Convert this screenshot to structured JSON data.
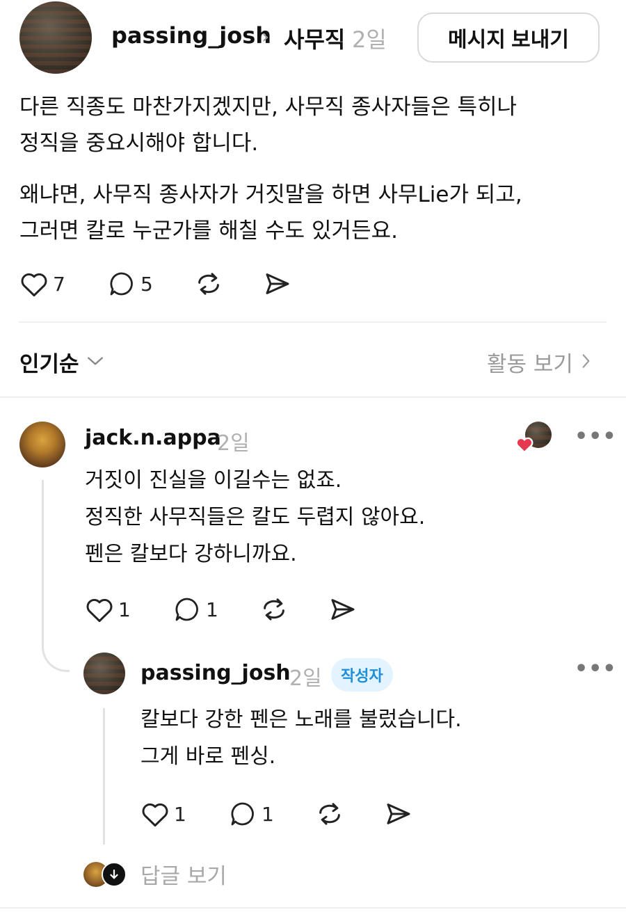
{
  "post": {
    "author": "passing_josh",
    "separator": "›",
    "category": "사무직",
    "time": "2일",
    "message_button": "메시지 보내기",
    "paragraphs": [
      "다른 직종도 마찬가지겠지만, 사무직 종사자들은 특히나",
      "정직을 중요시해야 합니다.",
      "왜냐면, 사무직 종사자가 거짓말을 하면 사무Lie가 되고,",
      "그러면 칼로 누군가를 해칠 수도 있거든요."
    ],
    "likes": "7",
    "comments": "5"
  },
  "sort": {
    "label": "인기순",
    "activity_link": "활동 보기"
  },
  "comments": [
    {
      "author": "jack.n.appa",
      "time": "2일",
      "lines": [
        "거짓이 진실을 이길수는 없죠.",
        "정직한 사무직들은 칼도 두렵지 않아요.",
        "펜은 칼보다 강하니까요."
      ],
      "likes": "1",
      "replies": "1",
      "more": "•••"
    },
    {
      "author": "passing_josh",
      "time": "2일",
      "badge": "작성자",
      "lines": [
        "칼보다 강한 펜은 노래를 불렀습니다.",
        "그게 바로 펜싱."
      ],
      "likes": "1",
      "replies": "1",
      "more": "•••"
    }
  ],
  "view_replies": "답글 보기",
  "colors": {
    "heart_red": "#e53950",
    "badge_bg": "#e3f3ff",
    "badge_text": "#1f8fd8",
    "muted": "#b0b0b0"
  },
  "icons": [
    "heart-icon",
    "comment-icon",
    "repost-icon",
    "share-icon",
    "chevron-down-icon",
    "chevron-right-icon",
    "more-icon",
    "arrow-down-icon"
  ]
}
